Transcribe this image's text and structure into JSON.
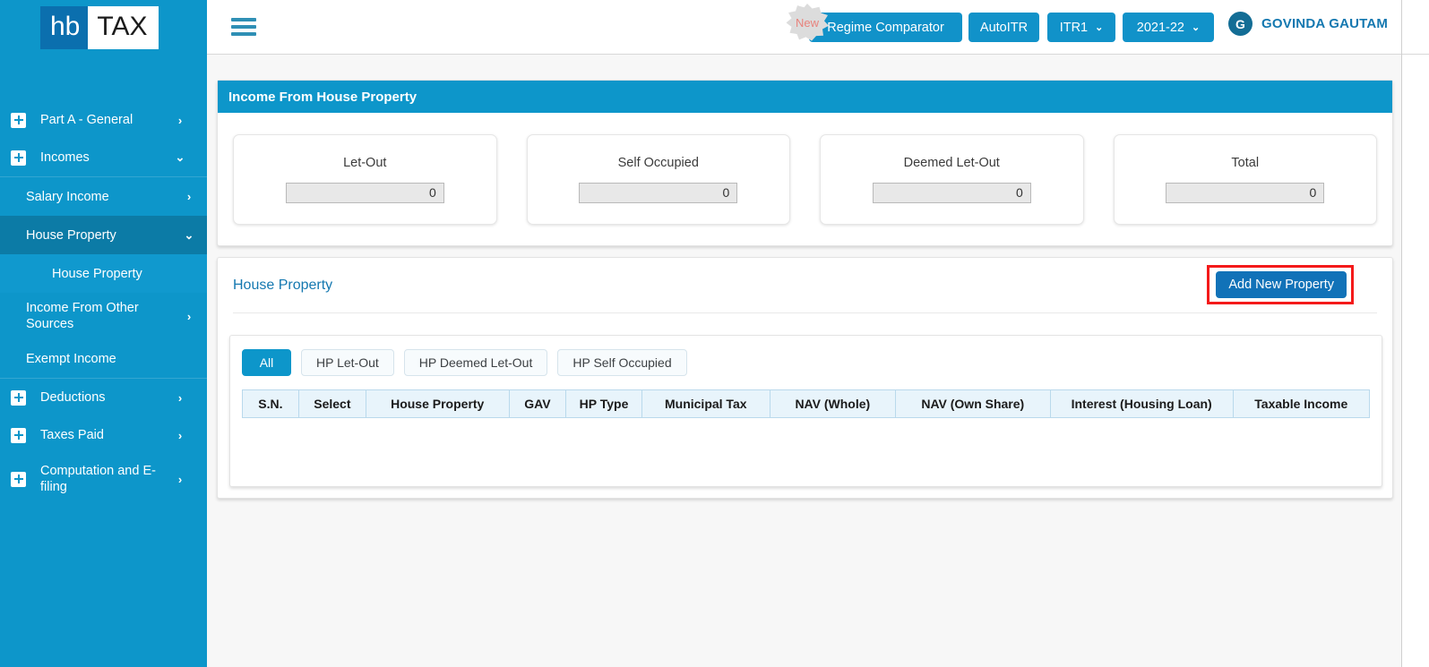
{
  "brand": {
    "logo_left": "hb",
    "logo_right": "TAX"
  },
  "sidebar": {
    "items": [
      {
        "label": "Part A - General",
        "icon": "plus-box-icon",
        "chevron": "›",
        "type": "top"
      },
      {
        "label": "Incomes",
        "icon": "plus-box-icon",
        "chevron": "⌄",
        "type": "top"
      },
      {
        "label": "Salary Income",
        "chevron": "›",
        "type": "sub"
      },
      {
        "label": "House Property",
        "chevron": "⌄",
        "type": "sub",
        "active": true
      },
      {
        "label": "House Property",
        "type": "sub2"
      },
      {
        "label": "Income From Other Sources",
        "chevron": "›",
        "type": "sub"
      },
      {
        "label": "Exempt Income",
        "type": "sub"
      },
      {
        "label": "Deductions",
        "icon": "plus-box-icon",
        "chevron": "›",
        "type": "top"
      },
      {
        "label": "Taxes Paid",
        "icon": "plus-box-icon",
        "chevron": "›",
        "type": "top"
      },
      {
        "label": "Computation and E-filing",
        "icon": "plus-box-icon",
        "chevron": "›",
        "type": "top"
      }
    ]
  },
  "header": {
    "new_badge": "New",
    "regime_comparator": "Regime Comparator",
    "auto_itr": "AutoITR",
    "itr_select": "ITR1",
    "year_select": "2021-22",
    "caret": "⌄",
    "avatar_initial": "G",
    "user_name": "GOVINDA GAUTAM"
  },
  "summary": {
    "title": "Income From House Property",
    "cards": [
      {
        "label": "Let-Out",
        "value": "0"
      },
      {
        "label": "Self Occupied",
        "value": "0"
      },
      {
        "label": "Deemed Let-Out",
        "value": "0"
      },
      {
        "label": "Total",
        "value": "0"
      }
    ]
  },
  "house_property": {
    "section_title": "House Property",
    "add_button": "Add New Property",
    "filters": [
      {
        "label": "All",
        "active": true
      },
      {
        "label": "HP Let-Out",
        "active": false
      },
      {
        "label": "HP Deemed Let-Out",
        "active": false
      },
      {
        "label": "HP Self Occupied",
        "active": false
      }
    ],
    "table": {
      "columns": [
        "S.N.",
        "Select",
        "House Property",
        "GAV",
        "HP Type",
        "Municipal Tax",
        "NAV (Whole)",
        "NAV (Own Share)",
        "Interest (Housing Loan)",
        "Taxable Income"
      ],
      "rows": []
    }
  },
  "colors": {
    "sidebar": "#0d96ca",
    "sidebar_active": "#0c7ba6",
    "accent": "#0d96ca",
    "primary_button": "#1172b8",
    "highlight_rect": "#f41a1a",
    "table_header": "#e8f4fb"
  }
}
